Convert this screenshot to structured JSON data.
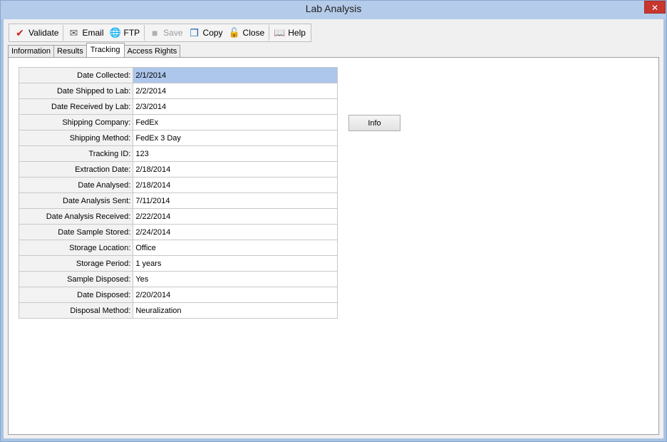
{
  "window": {
    "title": "Lab Analysis",
    "close_glyph": "✕"
  },
  "toolbar": {
    "validate": {
      "label": "Validate",
      "icon": "checkmark-icon",
      "glyph": "✔"
    },
    "email": {
      "label": "Email",
      "icon": "envelope-icon",
      "glyph": "✉"
    },
    "ftp": {
      "label": "FTP",
      "icon": "globe-icon",
      "glyph": "🌐"
    },
    "save": {
      "label": "Save",
      "icon": "save-icon",
      "glyph": "■"
    },
    "copy": {
      "label": "Copy",
      "icon": "copy-icon",
      "glyph": "❐"
    },
    "close": {
      "label": "Close",
      "icon": "lock-icon",
      "glyph": "🔓"
    },
    "help": {
      "label": "Help",
      "icon": "book-icon",
      "glyph": "📖"
    }
  },
  "tabs": [
    {
      "label": "Information",
      "active": false
    },
    {
      "label": "Results",
      "active": false
    },
    {
      "label": "Tracking",
      "active": true
    },
    {
      "label": "Access Rights",
      "active": false
    }
  ],
  "tracking": {
    "rows": [
      {
        "label": "Date Collected:",
        "value": "2/1/2014"
      },
      {
        "label": "Date Shipped to Lab:",
        "value": "2/2/2014"
      },
      {
        "label": "Date Received by Lab:",
        "value": "2/3/2014"
      },
      {
        "label": "Shipping Company:",
        "value": "FedEx"
      },
      {
        "label": "Shipping Method:",
        "value": "FedEx 3 Day"
      },
      {
        "label": "Tracking ID:",
        "value": "123"
      },
      {
        "label": "Extraction Date:",
        "value": "2/18/2014"
      },
      {
        "label": "Date Analysed:",
        "value": "2/18/2014"
      },
      {
        "label": "Date Analysis Sent:",
        "value": "7/11/2014"
      },
      {
        "label": "Date Analysis Received:",
        "value": "2/22/2014"
      },
      {
        "label": "Date Sample Stored:",
        "value": "2/24/2014"
      },
      {
        "label": "Storage Location:",
        "value": "Office"
      },
      {
        "label": "Storage Period:",
        "value": "1 years"
      },
      {
        "label": "Sample Disposed:",
        "value": "Yes"
      },
      {
        "label": "Date Disposed:",
        "value": "2/20/2014"
      },
      {
        "label": "Disposal Method:",
        "value": "Neuralization"
      }
    ],
    "info_button": "Info"
  },
  "colors": {
    "titlebar": "#b4cbea",
    "close_button": "#c7372f",
    "selected_cell": "#adc6ec",
    "validate_icon": "#d0201a",
    "copy_icon": "#1f5fb0",
    "help_icon": "#8b1a3a"
  }
}
